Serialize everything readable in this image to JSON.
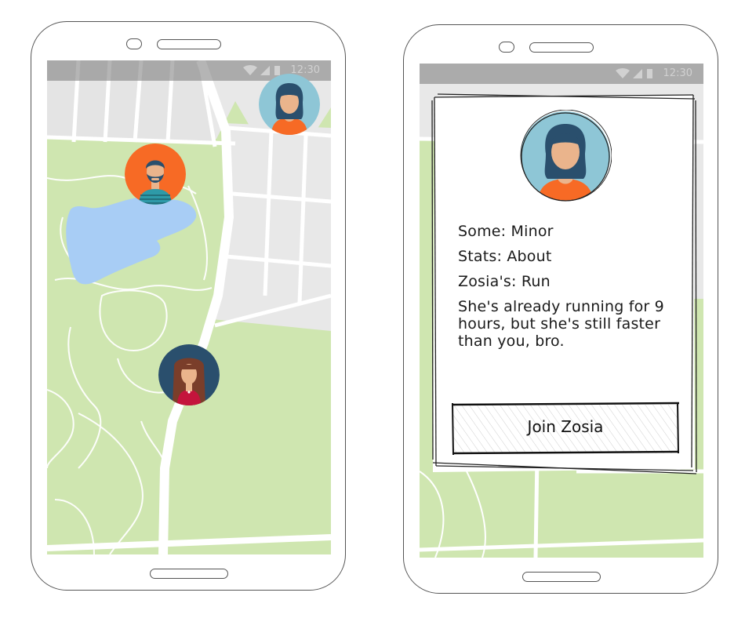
{
  "status_bar": {
    "time": "12:30"
  },
  "profile_card": {
    "line1": "Some: Minor",
    "line2": "Stats: About",
    "line3": "Zosia's: Run",
    "description": "She's already running for 9 hours, but she's still faster than you, bro.",
    "join_label": "Join Zosia"
  },
  "colors": {
    "map_park": "#cfe6b0",
    "map_urban": "#e8e8e8",
    "map_water": "#a8cdf5",
    "pin_blue": "#8ec6d6",
    "pin_orange": "#f76a25",
    "pin_navy": "#2a4f6d"
  }
}
